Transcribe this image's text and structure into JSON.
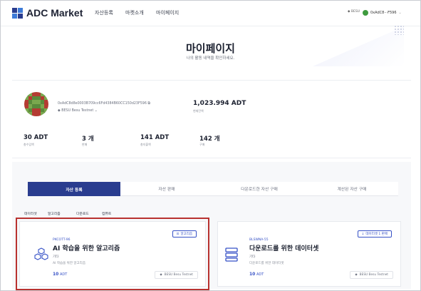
{
  "nav": {
    "brand": "ADC Market",
    "menu": [
      "자산등록",
      "마켓소개",
      "마이페이지"
    ],
    "network": "BESU",
    "wallet": "0xAdC8···F596",
    "colors": {
      "logo_dark": "#2a3d8f",
      "logo_light": "#3d7bd8",
      "wallet_dot": "#3e9b3e"
    }
  },
  "page": {
    "title": "마이페이지",
    "subtitle": "나의 활동 내역을 확인하세요."
  },
  "profile": {
    "address": "0xAdC8d8e0003B709cc6Fd4384B60CC150d23F596",
    "network": "BESU Besu Testnet",
    "balance": "1,023.994 ADT",
    "balance_label": "현재잔액",
    "stats": [
      {
        "value": "30 ADT",
        "label": "총수입액"
      },
      {
        "value": "3 개",
        "label": "판매"
      },
      {
        "value": "141 ADT",
        "label": "총지출액"
      },
      {
        "value": "142 개",
        "label": "구매"
      }
    ]
  },
  "tabs": [
    {
      "label": "자산 등록",
      "active": true
    },
    {
      "label": "자산 판매",
      "active": false
    },
    {
      "label": "다운로드한 자산 구매",
      "active": false
    },
    {
      "label": "계산된 자산 구매",
      "active": false
    }
  ],
  "filters": [
    "데이터셋",
    "알고리즘",
    "다운로드",
    "컴퓨트"
  ],
  "cards": [
    {
      "badge": "알고리즘",
      "code": "PKCOTT-96",
      "title": "AI 학습을 위한 알고리즘",
      "category": "기타",
      "description": "AI 학습을 위한 알고리즘",
      "price_value": "10",
      "price_unit": "ADT",
      "network": "BESU Besu Testnet",
      "icon": "algorithm-cubes-icon",
      "selected": true
    },
    {
      "badge": "데이터셋 1 판매",
      "code": "BLSWNA-55",
      "title": "다운로드를 위한 데이터셋",
      "category": "기타",
      "description": "다운로드를 위한 데이터셋",
      "price_value": "10",
      "price_unit": "ADT",
      "network": "BESU Besu Testnet",
      "icon": "dataset-server-icon",
      "selected": false
    }
  ]
}
